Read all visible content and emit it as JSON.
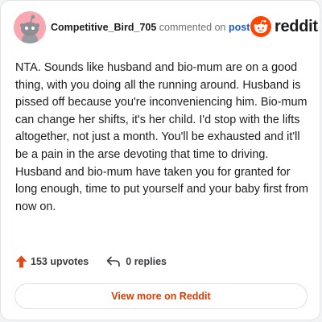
{
  "header": {
    "username": "Competitive_Bird_705",
    "action_text": "commented on",
    "post_link": "post",
    "brand_name": "reddit",
    "brand_icon": "reddit-snoo-icon",
    "avatar_icon": "snoo-avatar-icon"
  },
  "comment": {
    "text": "NTA. Sounds like husband and bio-mum are on a good thing, with you doing all the running around. Husband is pissed off because you're inconveniencing him. Bio-mum can change her shifts, it's her child. I'd stop with the lifts altogether, not just a month. You'll be exhausted and it'll be a pain in the arse devoting that time to driving. Husband and bio-mum have taken you for granted for long enough, time to put yourself and your baby first from now on."
  },
  "footer": {
    "upvotes": "153 upvotes",
    "replies": "0 replies",
    "upvote_icon": "upvote-arrow-icon",
    "reply_icon": "reply-arrow-icon"
  },
  "view_more_label": "View more on Reddit",
  "colors": {
    "accent": "#d93a00",
    "brand": "#ff4500",
    "link": "#1a5ad6",
    "avatar_bg": "#f7a8b0"
  }
}
